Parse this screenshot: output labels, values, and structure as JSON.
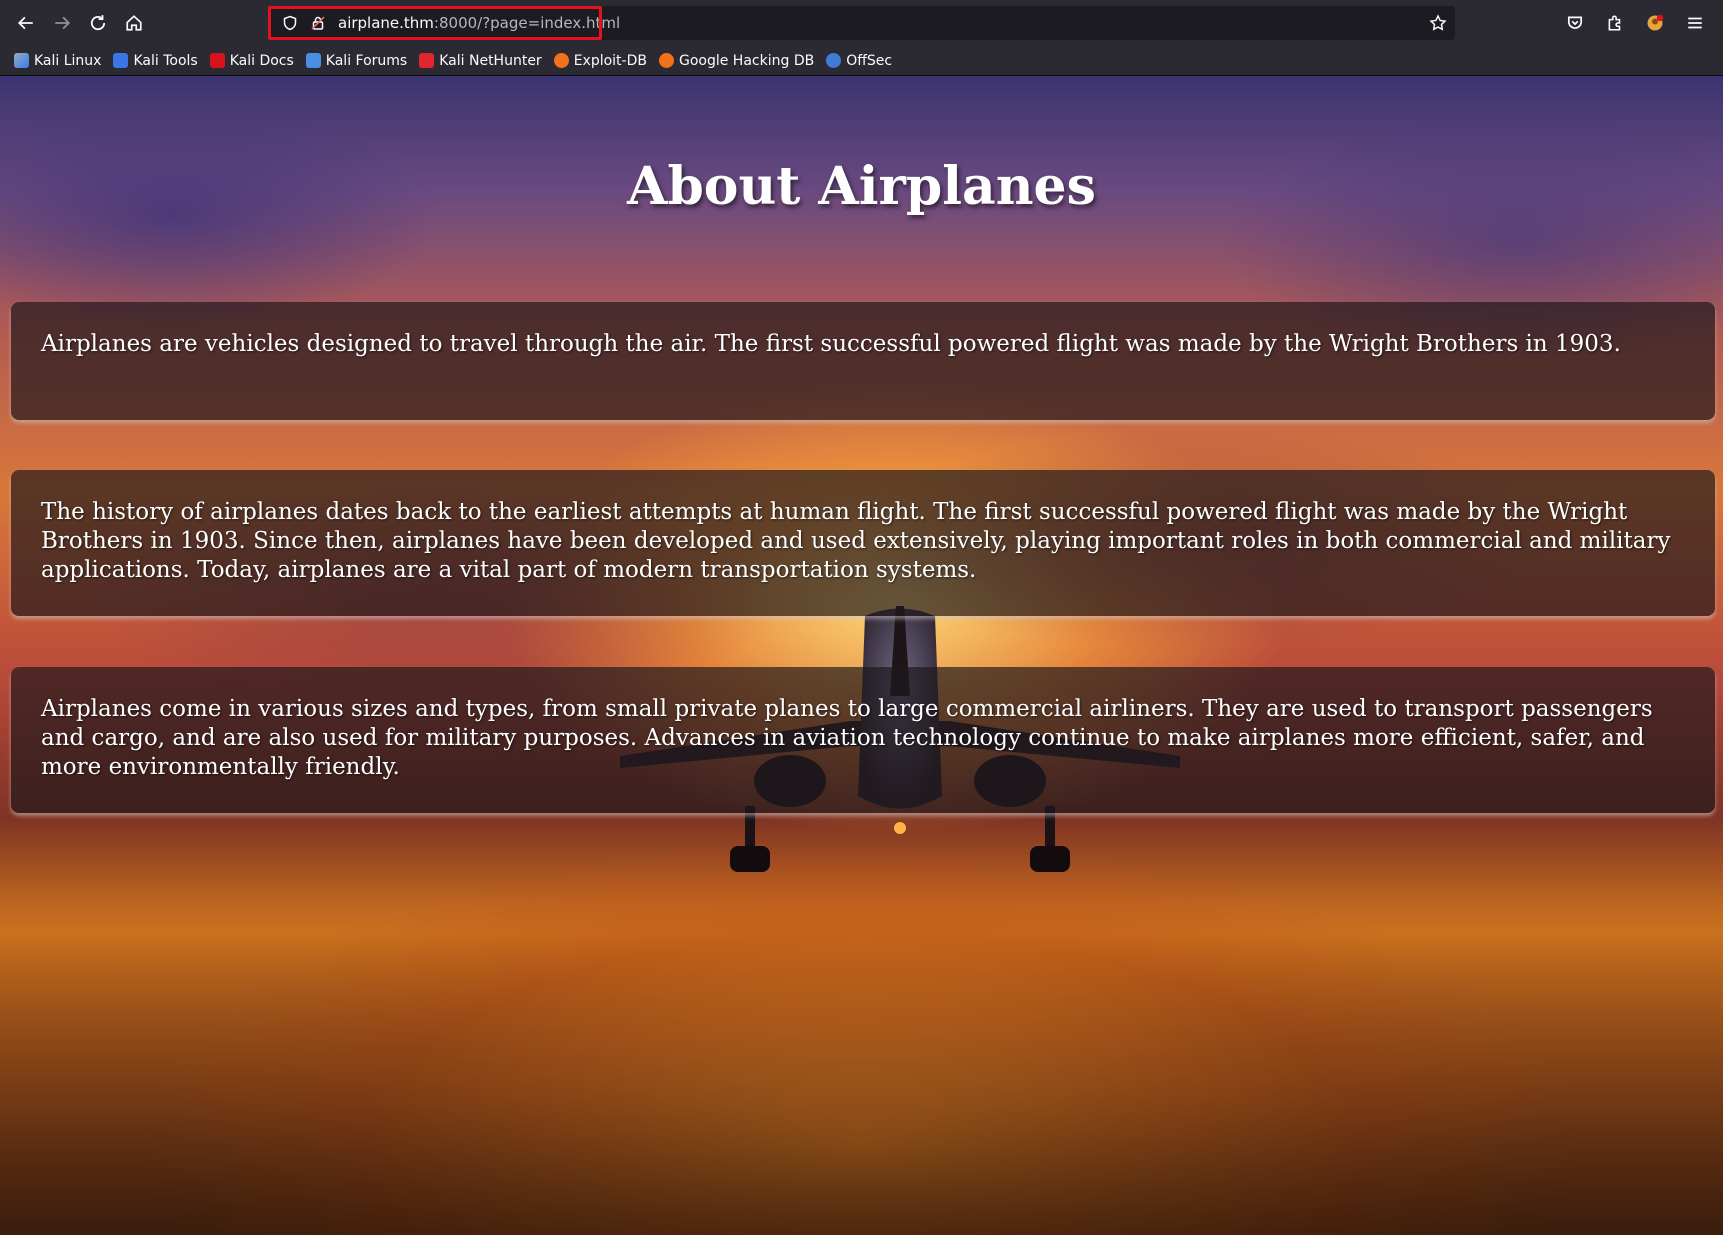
{
  "browser": {
    "url_host": "airplane.thm",
    "url_rest": ":8000/?page=index.html"
  },
  "bookmarks": [
    {
      "label": "Kali Linux",
      "icon": "kali-dragon-icon",
      "color": "#367bf0"
    },
    {
      "label": "Kali Tools",
      "icon": "kali-tools-icon",
      "color": "#3a76e8"
    },
    {
      "label": "Kali Docs",
      "icon": "kali-docs-icon",
      "color": "#d7141e"
    },
    {
      "label": "Kali Forums",
      "icon": "kali-forums-icon",
      "color": "#4a90e2"
    },
    {
      "label": "Kali NetHunter",
      "icon": "nethunter-icon",
      "color": "#e2262e"
    },
    {
      "label": "Exploit-DB",
      "icon": "exploit-db-icon",
      "color": "#f2711c"
    },
    {
      "label": "Google Hacking DB",
      "icon": "ghdb-icon",
      "color": "#f2711c"
    },
    {
      "label": "OffSec",
      "icon": "offsec-icon",
      "color": "#3e7cd6"
    }
  ],
  "page": {
    "title": "About Airplanes",
    "paragraphs": [
      "Airplanes are vehicles designed to travel through the air. The first successful powered flight was made by the Wright Brothers in 1903.",
      "The history of airplanes dates back to the earliest attempts at human flight. The first successful powered flight was made by the Wright Brothers in 1903. Since then, airplanes have been developed and used extensively, playing important roles in both commercial and military applications. Today, airplanes are a vital part of modern transportation systems.",
      "Airplanes come in various sizes and types, from small private planes to large commercial airliners. They are used to transport passengers and cargo, and are also used for military purposes. Advances in aviation technology continue to make airplanes more efficient, safer, and more environmentally friendly."
    ]
  }
}
